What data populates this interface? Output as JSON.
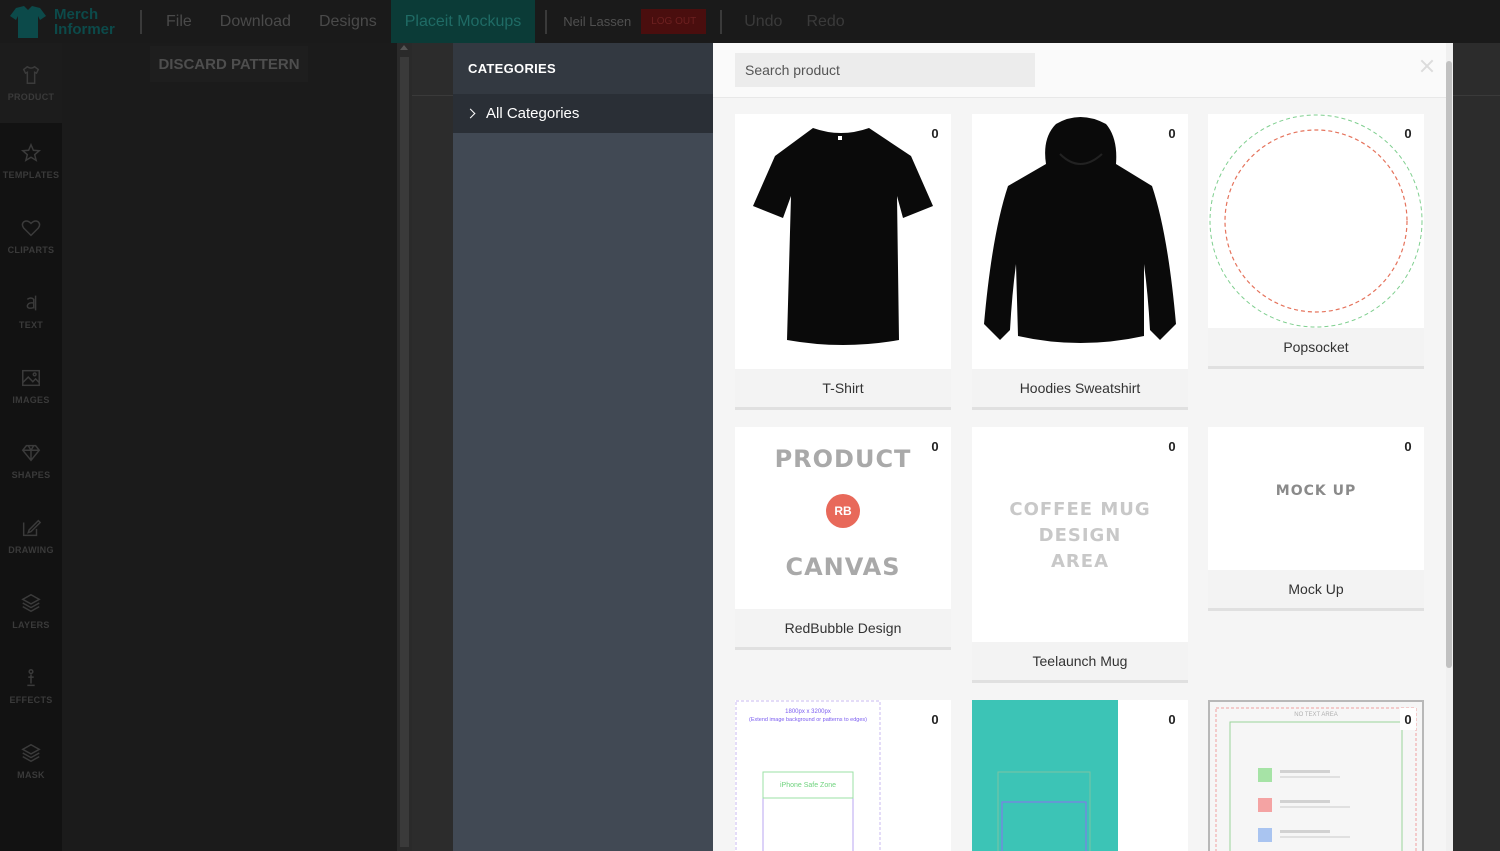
{
  "topbar": {
    "logo_line1": "Merch",
    "logo_line2": "Informer",
    "menu": [
      "File",
      "Download",
      "Designs",
      "Placeit Mockups"
    ],
    "user": "Neil Lassen",
    "logout": "LOG OUT",
    "undo": "Undo",
    "redo": "Redo"
  },
  "toolbar": [
    {
      "label": "PRODUCT",
      "icon": "shirt-icon"
    },
    {
      "label": "TEMPLATES",
      "icon": "star-icon"
    },
    {
      "label": "CLIPARTS",
      "icon": "heart-icon"
    },
    {
      "label": "TEXT",
      "icon": "text-icon"
    },
    {
      "label": "IMAGES",
      "icon": "image-icon"
    },
    {
      "label": "SHAPES",
      "icon": "diamond-icon"
    },
    {
      "label": "DRAWING",
      "icon": "edit-icon"
    },
    {
      "label": "LAYERS",
      "icon": "layers-icon"
    },
    {
      "label": "EFFECTS",
      "icon": "effects-icon"
    },
    {
      "label": "MASK",
      "icon": "mask-icon"
    }
  ],
  "editor": {
    "discard_label": "DISCARD PATTERN"
  },
  "categories": {
    "header": "CATEGORIES",
    "items": [
      "All Categories"
    ]
  },
  "products": {
    "search_placeholder": "Search product",
    "items": [
      {
        "name": "T-Shirt",
        "count": "0"
      },
      {
        "name": "Hoodies Sweatshirt",
        "count": "0"
      },
      {
        "name": "Popsocket",
        "count": "0"
      },
      {
        "name": "RedBubble Design",
        "count": "0",
        "art": [
          "PRODUCT",
          "RB",
          "CANVAS"
        ]
      },
      {
        "name": "Teelaunch Mug",
        "count": "0",
        "art": [
          "COFFEE MUG",
          "DESIGN",
          "AREA"
        ]
      },
      {
        "name": "Mock Up",
        "count": "0",
        "art": [
          "MOCK UP"
        ]
      },
      {
        "name": "",
        "count": "0",
        "art": [
          "1800px x 3200px",
          "(Extend image background or patterns to edges)",
          "iPhone Safe Zone"
        ]
      },
      {
        "name": "",
        "count": "0"
      },
      {
        "name": "",
        "count": "0",
        "art": [
          "NO TEXT AREA"
        ]
      }
    ]
  },
  "colors": {
    "accent": "#0b3b37",
    "teal_card": "#3cc4b6",
    "category_bg": "#414954"
  }
}
